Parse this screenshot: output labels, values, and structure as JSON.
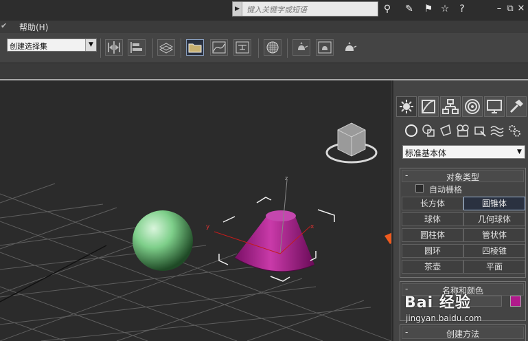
{
  "menu": {
    "help_label": "帮助(H)",
    "tick_glyph": "✔"
  },
  "search": {
    "placeholder": "键入关键字或短语"
  },
  "window_controls": {
    "minimize": "–",
    "restore": "⧉",
    "close": "✕"
  },
  "toolbar": {
    "selection_set": "创建选择集"
  },
  "panel": {
    "category": "标准基本体",
    "object_type": {
      "title": "对象类型",
      "autogrid": "自动栅格",
      "buttons": [
        {
          "label": "长方体",
          "selected": false
        },
        {
          "label": "圆锥体",
          "selected": true
        },
        {
          "label": "球体",
          "selected": false
        },
        {
          "label": "几何球体",
          "selected": false
        },
        {
          "label": "圆柱体",
          "selected": false
        },
        {
          "label": "管状体",
          "selected": false
        },
        {
          "label": "圆环",
          "selected": false
        },
        {
          "label": "四棱锥",
          "selected": false
        },
        {
          "label": "茶壶",
          "selected": false
        },
        {
          "label": "平面",
          "selected": false
        }
      ]
    },
    "name_color": {
      "title": "名称和颜色",
      "swatch_color": "#b01a8b"
    },
    "creation_method": {
      "title": "创建方法"
    },
    "collapse_glyph": "-"
  },
  "viewport": {
    "axis_x": "x",
    "axis_y": "y",
    "axis_z": "z",
    "sphere_color": "#7ecf8a",
    "cone_color": "#a81f8e",
    "arrow_color": "#ee5a1e"
  },
  "watermark": {
    "brand": "Bai 经验",
    "url": "jingyan.baidu.com"
  }
}
